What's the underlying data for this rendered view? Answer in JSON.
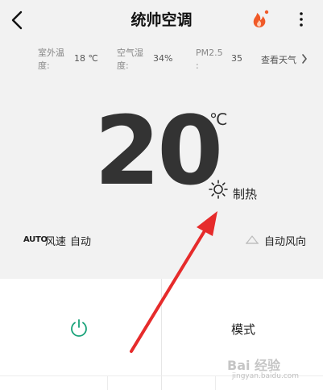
{
  "header": {
    "title": "统帅空调",
    "back_icon": "back-arrow-icon",
    "flame_icon": "flame-icon",
    "more_icon": "more-vertical-icon"
  },
  "info": {
    "outdoor_label_1": "室外温",
    "outdoor_label_2": "度:",
    "outdoor_value": "18 ℃",
    "humidity_label_1": "空气湿",
    "humidity_label_2": "度:",
    "humidity_value": "34%",
    "pm_label_1": "PM2.5",
    "pm_label_2": ":",
    "pm_value": "35",
    "weather_link": "查看天气"
  },
  "status": {
    "temperature": "20",
    "unit": "℃",
    "mode": "制热",
    "mode_icon": "sun-icon"
  },
  "controls": {
    "auto_badge": "AUTO",
    "fan_label": "风速",
    "fan_value": "自动",
    "wind_label": "自动风向",
    "wind_icon": "cloud-icon"
  },
  "panel": {
    "power_icon": "power-icon",
    "mode_button": "模式"
  },
  "watermark": {
    "text": "Bai 经验",
    "sub": "jingyan.baidu.com"
  },
  "colors": {
    "background": "#f2f2f2",
    "power_green": "#1aa37a",
    "flame_orange": "#f05a28",
    "annotation_red": "#e62b2b"
  }
}
